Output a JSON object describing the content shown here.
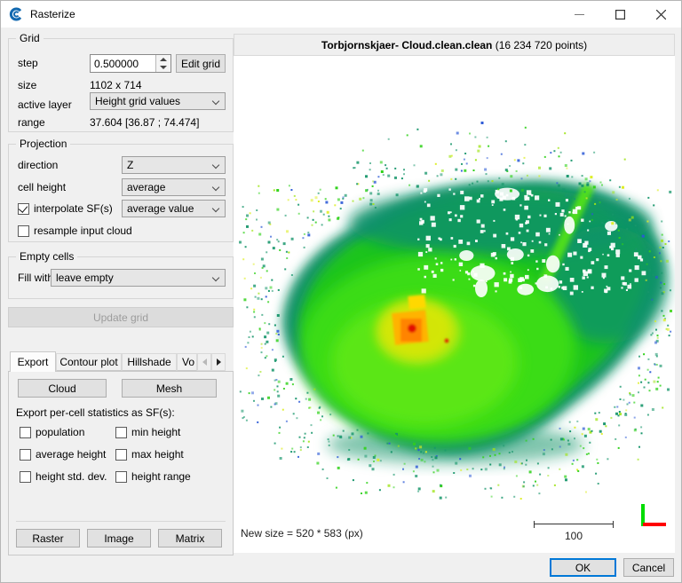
{
  "window": {
    "title": "Rasterize"
  },
  "grid": {
    "legend": "Grid",
    "step_label": "step",
    "step_value": "0.500000",
    "edit_grid_button": "Edit grid",
    "size_label": "size",
    "size_value": "1102 x 714",
    "active_layer_label": "active layer",
    "active_layer_value": "Height grid values",
    "range_label": "range",
    "range_value": "37.604 [36.87 ; 74.474]"
  },
  "projection": {
    "legend": "Projection",
    "direction_label": "direction",
    "direction_value": "Z",
    "cell_height_label": "cell height",
    "cell_height_value": "average",
    "interpolate_label": "interpolate SF(s)",
    "interpolate_checked": true,
    "interpolate_value": "average value",
    "resample_label": "resample input cloud",
    "resample_checked": false
  },
  "empty_cells": {
    "legend": "Empty cells",
    "fill_with_label": "Fill with",
    "fill_with_value": "leave empty"
  },
  "update_grid_button": "Update grid",
  "export_panel": {
    "tabs": [
      {
        "label": "Export",
        "active": true
      },
      {
        "label": "Contour plot",
        "active": false
      },
      {
        "label": "Hillshade",
        "active": false
      },
      {
        "label": "Vo",
        "active": false
      }
    ],
    "cloud_button": "Cloud",
    "mesh_button": "Mesh",
    "stats_caption": "Export per-cell statistics as SF(s):",
    "checkboxes": [
      {
        "label": "population",
        "checked": false
      },
      {
        "label": "min height",
        "checked": false
      },
      {
        "label": "average height",
        "checked": false
      },
      {
        "label": "max height",
        "checked": false
      },
      {
        "label": "height std. dev.",
        "checked": false
      },
      {
        "label": "height range",
        "checked": false
      }
    ],
    "raster_button": "Raster",
    "image_button": "Image",
    "matrix_button": "Matrix"
  },
  "preview": {
    "title_bold": "Torbjornskjaer- Cloud.clean.clean",
    "title_suffix": " (16 234 720 points)",
    "new_size_text": "New size = 520 * 583 (px)",
    "scale_label": "100"
  },
  "dialog_buttons": {
    "ok": "OK",
    "cancel": "Cancel"
  },
  "colors": {
    "accent": "#0078d7",
    "axis_x": "#ff0000",
    "axis_y": "#00dd00",
    "cloud_low": "#17966b",
    "cloud_mid": "#2fd119",
    "cloud_high": "#ff8400",
    "cloud_max": "#e31000"
  }
}
